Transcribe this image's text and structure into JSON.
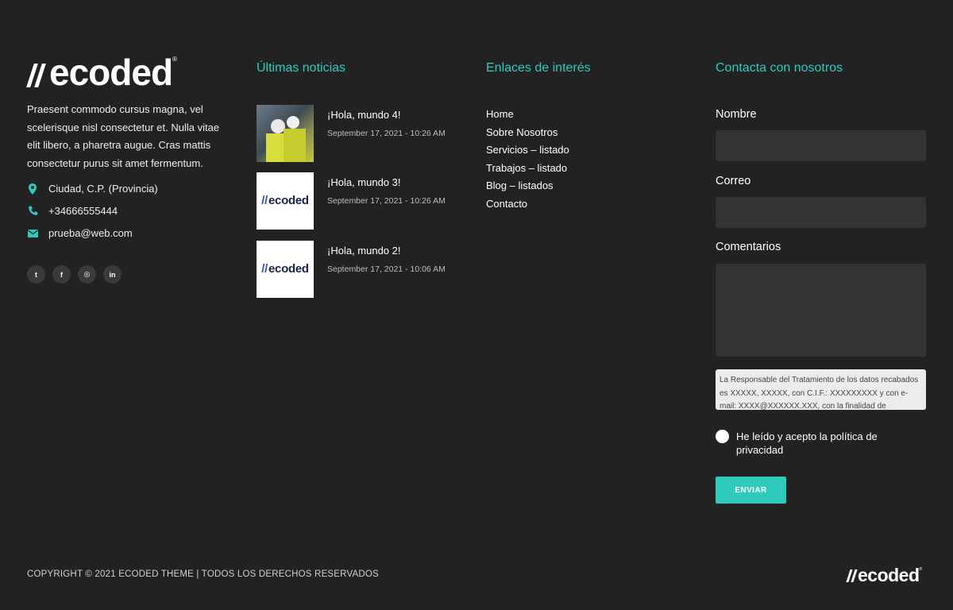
{
  "brand": {
    "logo_text": "ecoded",
    "registered_mark": "®"
  },
  "about": {
    "text": "Praesent commodo cursus magna, vel scelerisque nisl consectetur et. Nulla vitae elit libero, a pharetra augue. Cras mattis consectetur purus sit amet fermentum."
  },
  "contact_info": {
    "address": "Ciudad, C.P. (Provincia)",
    "phone": "+34666555444",
    "email": "prueba@web.com"
  },
  "social": [
    {
      "icon": "twitter-icon",
      "glyph": "t"
    },
    {
      "icon": "facebook-icon",
      "glyph": "f"
    },
    {
      "icon": "instagram-icon",
      "glyph": "◎"
    },
    {
      "icon": "linkedin-icon",
      "glyph": "in"
    }
  ],
  "news": {
    "heading": "Últimas noticias",
    "items": [
      {
        "title": "¡Hola, mundo 4!",
        "date": "September 17, 2021 - 10:26 AM",
        "thumb": "photo"
      },
      {
        "title": "¡Hola, mundo 3!",
        "date": "September 17, 2021 - 10:26 AM",
        "thumb": "logo"
      },
      {
        "title": "¡Hola, mundo 2!",
        "date": "September 17, 2021 - 10:06 AM",
        "thumb": "logo"
      }
    ],
    "thumb_logo_text": "ecoded"
  },
  "links": {
    "heading": "Enlaces de interés",
    "items": [
      "Home",
      "Sobre Nosotros",
      "Servicios – listado",
      "Trabajos – listado",
      "Blog – listados",
      "Contacto"
    ]
  },
  "contact_form": {
    "heading": "Contacta con nosotros",
    "name_label": "Nombre",
    "email_label": "Correo",
    "comments_label": "Comentarios",
    "legal_text": "La Responsable del Tratamiento de los datos recabados es XXXXX, XXXXX, con C.I.F.: XXXXXXXXX y con e-mail: XXXX@XXXXXX.XXX, con la finalidad de",
    "consent_text": "He leído y acepto la política de privacidad",
    "submit_label": "ENVIAR"
  },
  "footer": {
    "copyright": "COPYRIGHT © 2021 ECODED THEME | TODOS LOS DERECHOS RESERVADOS"
  },
  "colors": {
    "background": "#222222",
    "accent": "#2ecbbd",
    "field": "#333333"
  }
}
